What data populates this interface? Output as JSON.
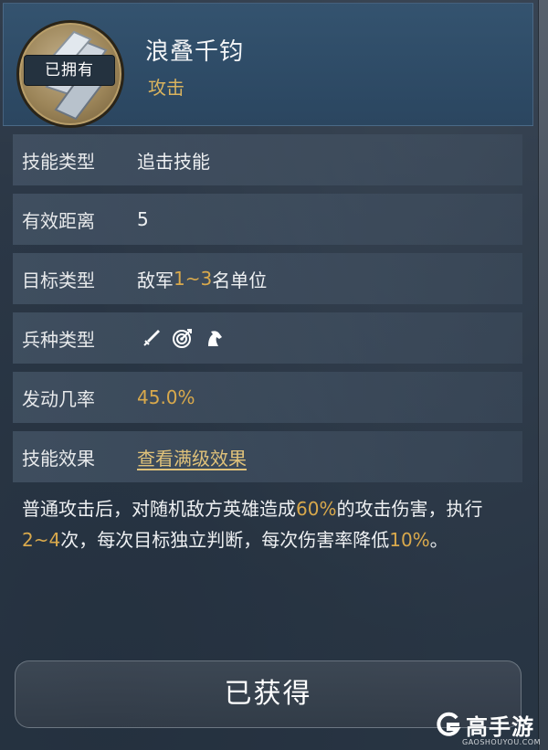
{
  "header": {
    "badge": "已拥有",
    "skill_name": "浪叠千钧",
    "skill_kind": "攻击"
  },
  "rows": [
    {
      "label": "技能类型",
      "value": "追击技能"
    },
    {
      "label": "有效距离",
      "value": "5"
    },
    {
      "label": "目标类型",
      "value_prefix": "敌军",
      "value_highlight": "1~3",
      "value_suffix": "名单位"
    },
    {
      "label": "兵种类型",
      "icons": [
        "sword-icon",
        "bow-target-icon",
        "horse-icon"
      ]
    },
    {
      "label": "发动几率",
      "value": "45.0%"
    },
    {
      "label": "技能效果",
      "link": "查看满级效果"
    }
  ],
  "description": {
    "p1": "普通攻击后，对随机敌方英雄造成",
    "h1": "60%",
    "p2": "的攻击伤害，执行",
    "h2": "2~4",
    "p3": "次，每次目标独立判断，每次伤害率降低",
    "h3": "10%",
    "p4": "。"
  },
  "button": {
    "label": "已获得"
  },
  "watermark": {
    "text": "高手游",
    "sub": "GAOSHOUYOU.COM"
  },
  "colors": {
    "highlight": "#d9a94c",
    "header_bg": "#2e4b66",
    "accent_gold": "#d9b35e"
  }
}
